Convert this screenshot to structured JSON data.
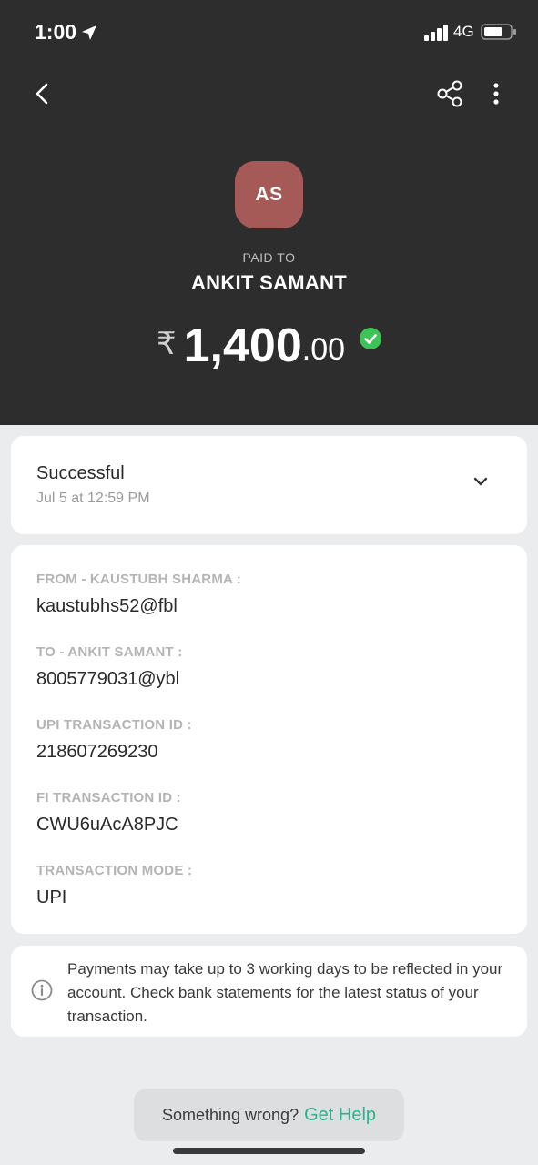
{
  "status_bar": {
    "time": "1:00",
    "network": "4G"
  },
  "header": {
    "avatar_initials": "AS",
    "paid_to_label": "PAID TO",
    "payee_name": "ANKIT SAMANT",
    "currency_symbol": "₹",
    "amount_whole": "1,400",
    "amount_decimal": ".00"
  },
  "status": {
    "title": "Successful",
    "date": "Jul 5 at 12:59 PM"
  },
  "details": [
    {
      "label": "FROM - KAUSTUBH SHARMA :",
      "value": "kaustubhs52@fbl"
    },
    {
      "label": "TO - ANKIT SAMANT :",
      "value": "8005779031@ybl"
    },
    {
      "label": "UPI TRANSACTION ID :",
      "value": "218607269230"
    },
    {
      "label": "FI TRANSACTION ID :",
      "value": "CWU6uAcA8PJC"
    },
    {
      "label": "TRANSACTION MODE :",
      "value": "UPI"
    }
  ],
  "info": {
    "text": "Payments may take up to 3 working days to be reflected in your account. Check bank statements for the latest status of your transaction."
  },
  "help": {
    "prefix": "Something wrong?",
    "link": "Get Help"
  },
  "colors": {
    "header_bg": "#2d2d2d",
    "avatar_bg": "#a65a58",
    "success_green": "#3ec456",
    "link_green": "#2bb38f",
    "page_bg": "#ebecee"
  },
  "icons": [
    "back-icon",
    "share-icon",
    "more-icon",
    "success-check-icon",
    "chevron-down-icon",
    "info-icon",
    "location-arrow-icon",
    "signal-icon",
    "battery-icon"
  ]
}
